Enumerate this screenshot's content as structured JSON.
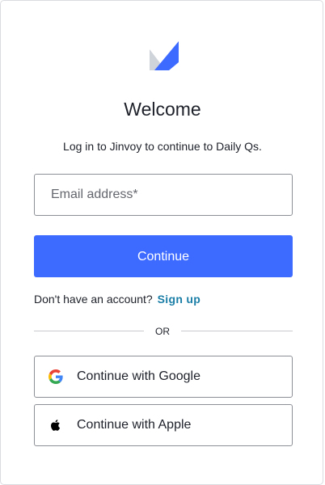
{
  "header": {
    "title": "Welcome",
    "subtitle": "Log in to Jinvoy to continue to Daily Qs."
  },
  "form": {
    "email_placeholder": "Email address*",
    "email_value": "",
    "continue_label": "Continue"
  },
  "signup": {
    "prompt": "Don't have an account?",
    "link_label": "Sign up"
  },
  "divider": {
    "label": "OR"
  },
  "social": {
    "google_label": "Continue with Google",
    "apple_label": "Continue with Apple"
  },
  "colors": {
    "primary": "#3d6aff",
    "link": "#1a7ea6",
    "text": "#1e212a",
    "border": "#8c8f96"
  },
  "icons": {
    "logo": "brand-logo-icon",
    "google": "google-icon",
    "apple": "apple-icon"
  }
}
